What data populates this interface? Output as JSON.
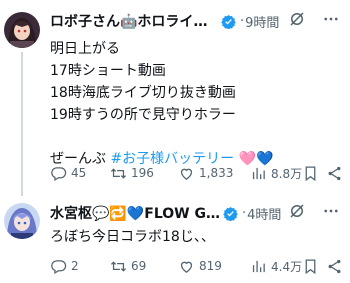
{
  "tweets": [
    {
      "name": "ロボ子さん🤖ホロライブ...",
      "time_sep": "·",
      "time": "9時間",
      "lines": [
        "明日上がる",
        "17時ショート動画",
        "18時海底ライブ切り抜き動画",
        "19時すうの所で見守りホラー"
      ],
      "last_line_prefix": "ぜーんぶ ",
      "hashtag": "#お子様バッテリー",
      "emoji_pink_heart": "🩷",
      "emoji_blue_heart": "💙",
      "stats": {
        "replies": "45",
        "retweets": "196",
        "likes": "1,833",
        "views": "8.8万"
      }
    },
    {
      "name": "水宮枢💬🔁💙FLOW GL...",
      "time_sep": "·",
      "time": "4時間",
      "lines": [
        "ろぼち今日コラボ18じ、、"
      ],
      "stats": {
        "replies": "2",
        "retweets": "69",
        "likes": "819",
        "views": "4.4万"
      }
    }
  ],
  "colors": {
    "verified": "#1d9bf0",
    "hashtag": "#1d9bf0",
    "muted": "#536471",
    "thread_line": "#cfd9de"
  }
}
